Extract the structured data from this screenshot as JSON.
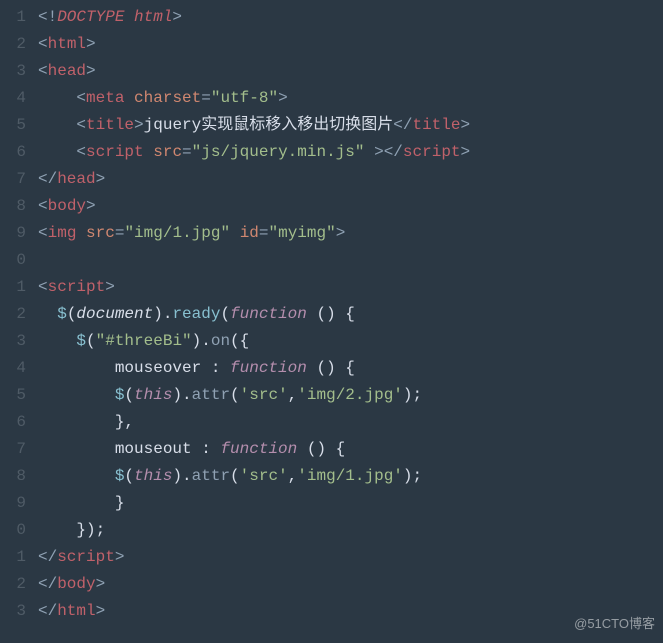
{
  "watermark": "@51CTO博客",
  "lines": [
    {
      "n": "1",
      "tokens": [
        {
          "t": "<!",
          "c": "c-punc"
        },
        {
          "t": "DOCTYPE html",
          "c": "c-doctype"
        },
        {
          "t": ">",
          "c": "c-punc"
        }
      ]
    },
    {
      "n": "2",
      "tokens": [
        {
          "t": "<",
          "c": "c-punc"
        },
        {
          "t": "html",
          "c": "c-tag"
        },
        {
          "t": ">",
          "c": "c-punc"
        }
      ]
    },
    {
      "n": "3",
      "tokens": [
        {
          "t": "<",
          "c": "c-punc"
        },
        {
          "t": "head",
          "c": "c-tag"
        },
        {
          "t": ">",
          "c": "c-punc"
        }
      ]
    },
    {
      "n": "4",
      "tokens": [
        {
          "t": "    ",
          "c": "c-text"
        },
        {
          "t": "<",
          "c": "c-punc"
        },
        {
          "t": "meta",
          "c": "c-tag"
        },
        {
          "t": " ",
          "c": "c-text"
        },
        {
          "t": "charset",
          "c": "c-attr"
        },
        {
          "t": "=",
          "c": "c-punc"
        },
        {
          "t": "\"utf-8\"",
          "c": "c-string"
        },
        {
          "t": ">",
          "c": "c-punc"
        }
      ]
    },
    {
      "n": "5",
      "tokens": [
        {
          "t": "    ",
          "c": "c-text"
        },
        {
          "t": "<",
          "c": "c-punc"
        },
        {
          "t": "title",
          "c": "c-tag"
        },
        {
          "t": ">",
          "c": "c-punc"
        },
        {
          "t": "jquery实现鼠标移入移出切换图片",
          "c": "c-text"
        },
        {
          "t": "</",
          "c": "c-punc"
        },
        {
          "t": "title",
          "c": "c-tag"
        },
        {
          "t": ">",
          "c": "c-punc"
        }
      ]
    },
    {
      "n": "6",
      "tokens": [
        {
          "t": "    ",
          "c": "c-text"
        },
        {
          "t": "<",
          "c": "c-punc"
        },
        {
          "t": "script",
          "c": "c-tag"
        },
        {
          "t": " ",
          "c": "c-text"
        },
        {
          "t": "src",
          "c": "c-attr"
        },
        {
          "t": "=",
          "c": "c-punc"
        },
        {
          "t": "\"js/jquery.min.js\"",
          "c": "c-string"
        },
        {
          "t": " ",
          "c": "c-text"
        },
        {
          "t": "></",
          "c": "c-punc"
        },
        {
          "t": "script",
          "c": "c-tag"
        },
        {
          "t": ">",
          "c": "c-punc"
        }
      ]
    },
    {
      "n": "7",
      "tokens": [
        {
          "t": "</",
          "c": "c-punc"
        },
        {
          "t": "head",
          "c": "c-tag"
        },
        {
          "t": ">",
          "c": "c-punc"
        }
      ]
    },
    {
      "n": "8",
      "tokens": [
        {
          "t": "<",
          "c": "c-punc"
        },
        {
          "t": "body",
          "c": "c-tag"
        },
        {
          "t": ">",
          "c": "c-punc"
        }
      ]
    },
    {
      "n": "9",
      "tokens": [
        {
          "t": "<",
          "c": "c-punc"
        },
        {
          "t": "img",
          "c": "c-tag"
        },
        {
          "t": " ",
          "c": "c-text"
        },
        {
          "t": "src",
          "c": "c-attr"
        },
        {
          "t": "=",
          "c": "c-punc"
        },
        {
          "t": "\"img/1.jpg\"",
          "c": "c-string"
        },
        {
          "t": " ",
          "c": "c-text"
        },
        {
          "t": "id",
          "c": "c-attr"
        },
        {
          "t": "=",
          "c": "c-punc"
        },
        {
          "t": "\"myimg\"",
          "c": "c-string"
        },
        {
          "t": ">",
          "c": "c-punc"
        }
      ]
    },
    {
      "n": "0",
      "tokens": [
        {
          "t": " ",
          "c": "c-text"
        }
      ]
    },
    {
      "n": "1",
      "tokens": [
        {
          "t": "<",
          "c": "c-punc"
        },
        {
          "t": "script",
          "c": "c-tag"
        },
        {
          "t": ">",
          "c": "c-punc"
        }
      ]
    },
    {
      "n": "2",
      "tokens": [
        {
          "t": "  ",
          "c": "c-text"
        },
        {
          "t": "$",
          "c": "c-dollar"
        },
        {
          "t": "(",
          "c": "c-punc2"
        },
        {
          "t": "document",
          "c": "c-var-it"
        },
        {
          "t": ").",
          "c": "c-punc2"
        },
        {
          "t": "ready",
          "c": "c-func"
        },
        {
          "t": "(",
          "c": "c-punc2"
        },
        {
          "t": "function",
          "c": "c-keyword-it"
        },
        {
          "t": " () {",
          "c": "c-punc2"
        }
      ]
    },
    {
      "n": "3",
      "tokens": [
        {
          "t": "    ",
          "c": "c-text"
        },
        {
          "t": "$",
          "c": "c-dollar"
        },
        {
          "t": "(",
          "c": "c-punc2"
        },
        {
          "t": "\"#threeBi\"",
          "c": "c-string"
        },
        {
          "t": ").",
          "c": "c-punc2"
        },
        {
          "t": "on",
          "c": "c-method"
        },
        {
          "t": "({",
          "c": "c-punc2"
        }
      ]
    },
    {
      "n": "4",
      "tokens": [
        {
          "t": "        ",
          "c": "c-text"
        },
        {
          "t": "mouseover",
          "c": "c-prop"
        },
        {
          "t": " : ",
          "c": "c-punc2"
        },
        {
          "t": "function",
          "c": "c-keyword-it"
        },
        {
          "t": " () {",
          "c": "c-punc2"
        }
      ]
    },
    {
      "n": "5",
      "tokens": [
        {
          "t": "        ",
          "c": "c-text"
        },
        {
          "t": "$",
          "c": "c-dollar"
        },
        {
          "t": "(",
          "c": "c-punc2"
        },
        {
          "t": "this",
          "c": "c-keyword-it"
        },
        {
          "t": ").",
          "c": "c-punc2"
        },
        {
          "t": "attr",
          "c": "c-method"
        },
        {
          "t": "(",
          "c": "c-punc2"
        },
        {
          "t": "'src'",
          "c": "c-string"
        },
        {
          "t": ",",
          "c": "c-punc2"
        },
        {
          "t": "'img/2.jpg'",
          "c": "c-string"
        },
        {
          "t": ");",
          "c": "c-punc2"
        }
      ]
    },
    {
      "n": "6",
      "tokens": [
        {
          "t": "        },",
          "c": "c-punc2"
        }
      ]
    },
    {
      "n": "7",
      "tokens": [
        {
          "t": "        ",
          "c": "c-text"
        },
        {
          "t": "mouseout",
          "c": "c-prop"
        },
        {
          "t": " : ",
          "c": "c-punc2"
        },
        {
          "t": "function",
          "c": "c-keyword-it"
        },
        {
          "t": " () {",
          "c": "c-punc2"
        }
      ]
    },
    {
      "n": "8",
      "tokens": [
        {
          "t": "        ",
          "c": "c-text"
        },
        {
          "t": "$",
          "c": "c-dollar"
        },
        {
          "t": "(",
          "c": "c-punc2"
        },
        {
          "t": "this",
          "c": "c-keyword-it"
        },
        {
          "t": ").",
          "c": "c-punc2"
        },
        {
          "t": "attr",
          "c": "c-method"
        },
        {
          "t": "(",
          "c": "c-punc2"
        },
        {
          "t": "'src'",
          "c": "c-string"
        },
        {
          "t": ",",
          "c": "c-punc2"
        },
        {
          "t": "'img/1.jpg'",
          "c": "c-string"
        },
        {
          "t": ");",
          "c": "c-punc2"
        }
      ]
    },
    {
      "n": "9",
      "tokens": [
        {
          "t": "        }",
          "c": "c-punc2"
        }
      ]
    },
    {
      "n": "0",
      "tokens": [
        {
          "t": "    });",
          "c": "c-punc2"
        }
      ]
    },
    {
      "n": "1",
      "tokens": [
        {
          "t": "</",
          "c": "c-punc"
        },
        {
          "t": "script",
          "c": "c-tag"
        },
        {
          "t": ">",
          "c": "c-punc"
        }
      ]
    },
    {
      "n": "2",
      "tokens": [
        {
          "t": "</",
          "c": "c-punc"
        },
        {
          "t": "body",
          "c": "c-tag"
        },
        {
          "t": ">",
          "c": "c-punc"
        }
      ]
    },
    {
      "n": "3",
      "tokens": [
        {
          "t": "</",
          "c": "c-punc"
        },
        {
          "t": "html",
          "c": "c-tag"
        },
        {
          "t": ">",
          "c": "c-punc"
        }
      ]
    }
  ]
}
